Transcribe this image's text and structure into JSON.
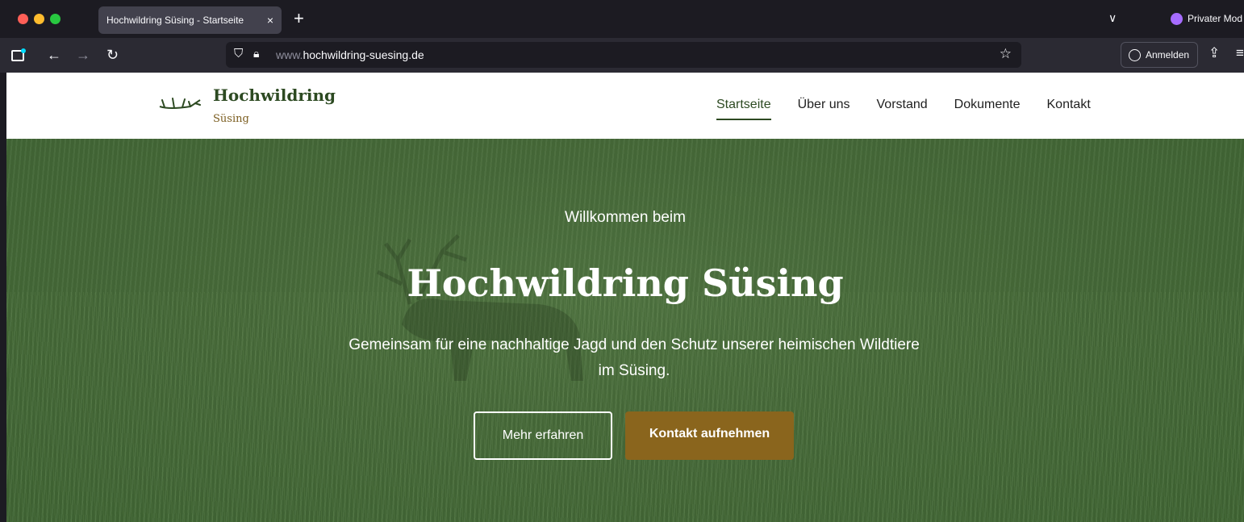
{
  "browser": {
    "tab_title": "Hochwildring Süsing - Startseite",
    "tab_close": "×",
    "new_tab": "+",
    "tab_list": "∨",
    "private_label": "Privater Mod",
    "url_prefix": "www.",
    "url_domain": "hochwildring-suesing.de",
    "signin_label": "Anmelden"
  },
  "site": {
    "logo_title": "Hochwildring",
    "logo_sub": "Süsing",
    "nav": [
      "Startseite",
      "Über uns",
      "Vorstand",
      "Dokumente",
      "Kontakt"
    ],
    "active_nav": "Startseite"
  },
  "hero": {
    "kicker": "Willkommen beim",
    "title": "Hochwildring Süsing",
    "text": "Gemeinsam für eine nachhaltige Jagd und den Schutz unserer heimischen Wildtiere im Süsing.",
    "btn_more": "Mehr erfahren",
    "btn_contact": "Kontakt aufnehmen"
  },
  "colors": {
    "brand_green": "#2d4a22",
    "brand_brown": "#8a651d",
    "hero_green": "#476a39"
  }
}
